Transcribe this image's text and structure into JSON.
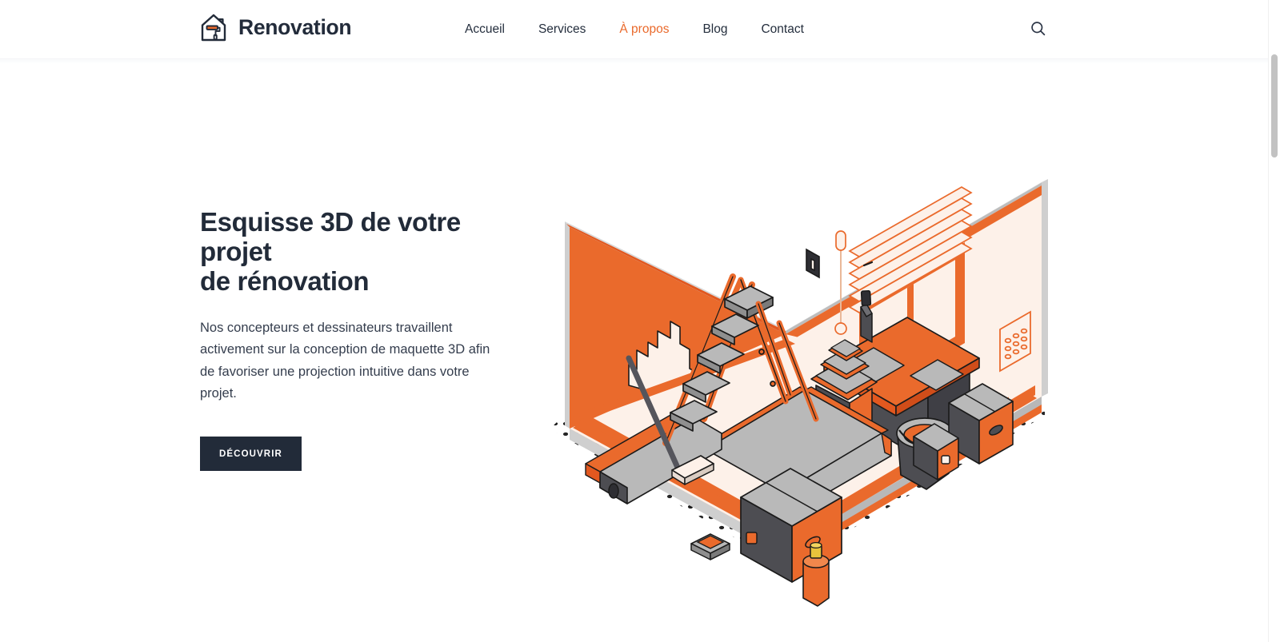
{
  "brand": {
    "name": "Renovation",
    "logo_icon": "house-paint-roller-icon"
  },
  "nav": {
    "items": [
      {
        "label": "Accueil",
        "active": false
      },
      {
        "label": "Services",
        "active": false
      },
      {
        "label": "À propos",
        "active": true
      },
      {
        "label": "Blog",
        "active": false
      },
      {
        "label": "Contact",
        "active": false
      }
    ],
    "search_icon": "search-icon"
  },
  "hero": {
    "title": "Esquisse 3D de votre projet de rénovation",
    "title_line_1": "Esquisse 3D de votre projet",
    "title_line_2": "de rénovation",
    "paragraph": "Nos concepteurs et dessinateurs travaillent activement sur la conception de maquette 3D afin de favoriser une projection intuitive dans votre projet.",
    "cta_label": "DÉCOUVRIR",
    "illustration_alt": "isometric-room-renovation-illustration"
  },
  "colors": {
    "accent_orange": "#ea6a2c",
    "orange_dark": "#e2581f",
    "ink_navy": "#222b39",
    "body_text": "#343d4d",
    "page_bg": "#ffffff",
    "floor_cream": "#fdf1e9",
    "grey_light": "#c9c9c9",
    "grey_mid": "#a9a9a9",
    "grey_dark": "#4d4d52",
    "outline": "#1b1b1b"
  },
  "scrollbar": {
    "orientation": "vertical",
    "thumb_top_pct": 8,
    "thumb_height_pct": 16
  }
}
